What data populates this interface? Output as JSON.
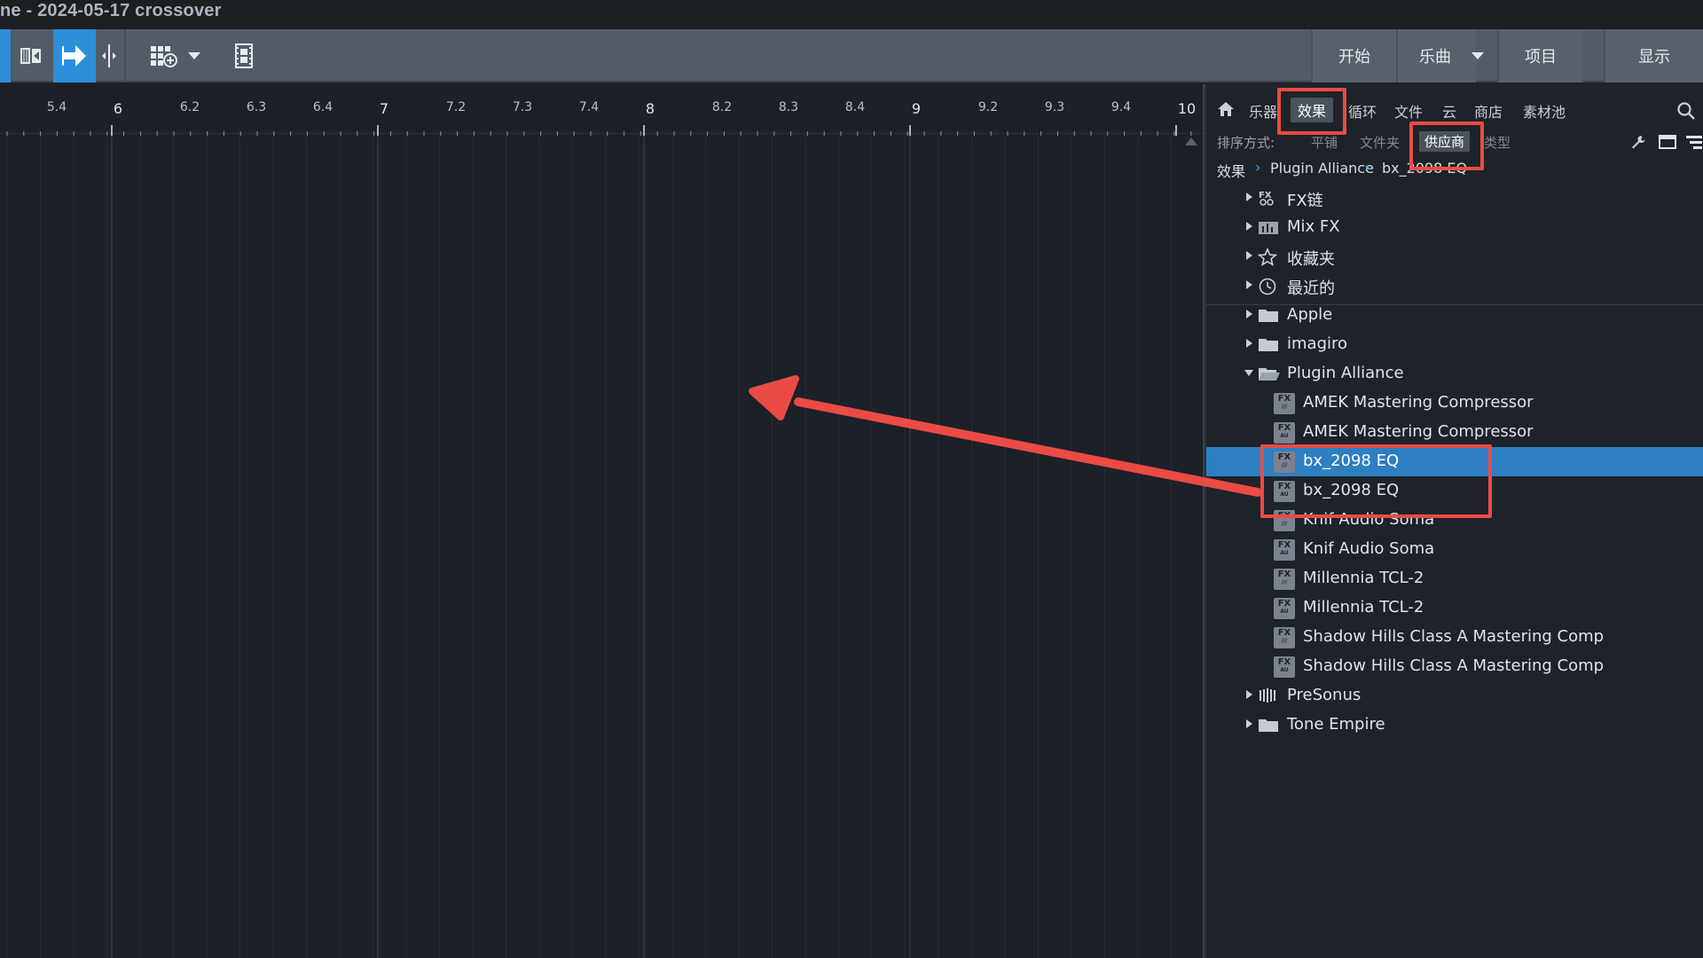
{
  "window": {
    "title": "ne - 2024-05-17 crossover"
  },
  "toolbar": {
    "tools": [
      {
        "name": "loop-tool",
        "icon": "film-bracket-icon"
      },
      {
        "name": "arrow-tool",
        "icon": "arrow-right-icon",
        "active": true
      },
      {
        "name": "split-tool",
        "icon": "split-cursor-icon"
      },
      {
        "name": "grid-add-tool",
        "icon": "grid-plus-icon"
      },
      {
        "name": "video-tool",
        "icon": "film-icon"
      }
    ],
    "nav": {
      "start": "开始",
      "song": "乐曲",
      "project": "项目",
      "show": "显示"
    }
  },
  "ruler": {
    "labels": [
      "5.4",
      "6",
      "6.2",
      "6.3",
      "6.4",
      "7",
      "7.2",
      "7.3",
      "7.4",
      "8",
      "8.2",
      "8.3",
      "8.4",
      "9",
      "9.2",
      "9.3",
      "9.4",
      "10"
    ]
  },
  "browser": {
    "tabs": [
      "乐器",
      "效果",
      "循环",
      "文件",
      "云",
      "商店",
      "素材池"
    ],
    "active_tab": "效果",
    "sort": {
      "label": "排序方式:",
      "options": [
        "平铺",
        "文件夹",
        "供应商",
        "类型"
      ],
      "active": "供应商"
    },
    "breadcrumb": [
      "效果",
      "Plugin Alliance",
      "bx_2098 EQ"
    ],
    "tree": [
      {
        "label": "FX链",
        "icon": "fx-chain-icon",
        "level": 0,
        "expand": "collapsed"
      },
      {
        "label": "Mix FX",
        "icon": "mix-fx-icon",
        "level": 0,
        "expand": "collapsed"
      },
      {
        "label": "收藏夹",
        "icon": "star-icon",
        "level": 0,
        "expand": "collapsed"
      },
      {
        "label": "最近的",
        "icon": "clock-icon",
        "level": 0,
        "expand": "collapsed"
      },
      {
        "label": "Apple",
        "icon": "folder-icon",
        "level": 0,
        "expand": "collapsed"
      },
      {
        "label": "imagiro",
        "icon": "folder-icon",
        "level": 0,
        "expand": "collapsed"
      },
      {
        "label": "Plugin Alliance",
        "icon": "folder-open-icon",
        "level": 0,
        "expand": "expanded"
      },
      {
        "label": "AMEK Mastering Compressor",
        "icon": "fx-plugin-icon",
        "format": "VST",
        "level": 1
      },
      {
        "label": "AMEK Mastering Compressor",
        "icon": "fx-plugin-icon",
        "format": "AU",
        "level": 1
      },
      {
        "label": "bx_2098 EQ",
        "icon": "fx-plugin-icon",
        "format": "VST",
        "level": 1,
        "selected": true
      },
      {
        "label": "bx_2098 EQ",
        "icon": "fx-plugin-icon",
        "format": "AU",
        "level": 1
      },
      {
        "label": "Knif Audio Soma",
        "icon": "fx-plugin-icon",
        "format": "VST",
        "level": 1
      },
      {
        "label": "Knif Audio Soma",
        "icon": "fx-plugin-icon",
        "format": "AU",
        "level": 1
      },
      {
        "label": "Millennia TCL-2",
        "icon": "fx-plugin-icon",
        "format": "VST",
        "level": 1
      },
      {
        "label": "Millennia TCL-2",
        "icon": "fx-plugin-icon",
        "format": "AU",
        "level": 1
      },
      {
        "label": "Shadow Hills Class A Mastering Comp",
        "icon": "fx-plugin-icon",
        "format": "VST",
        "level": 1
      },
      {
        "label": "Shadow Hills Class A Mastering Comp",
        "icon": "fx-plugin-icon",
        "format": "AU",
        "level": 1
      },
      {
        "label": "PreSonus",
        "icon": "presonus-icon",
        "level": 0,
        "expand": "collapsed"
      },
      {
        "label": "Tone Empire",
        "icon": "folder-icon",
        "level": 0,
        "expand": "collapsed"
      }
    ]
  },
  "annotation": {
    "color": "#ea4b45",
    "highlighted": [
      "effects-tab",
      "vendor-sort",
      "bx_2098-eq-items"
    ],
    "arrow": "drag-from-browser-to-timeline"
  },
  "colors": {
    "accent": "#2d8fd9",
    "selection": "#2e7fc1",
    "annotation": "#ea4b45"
  }
}
